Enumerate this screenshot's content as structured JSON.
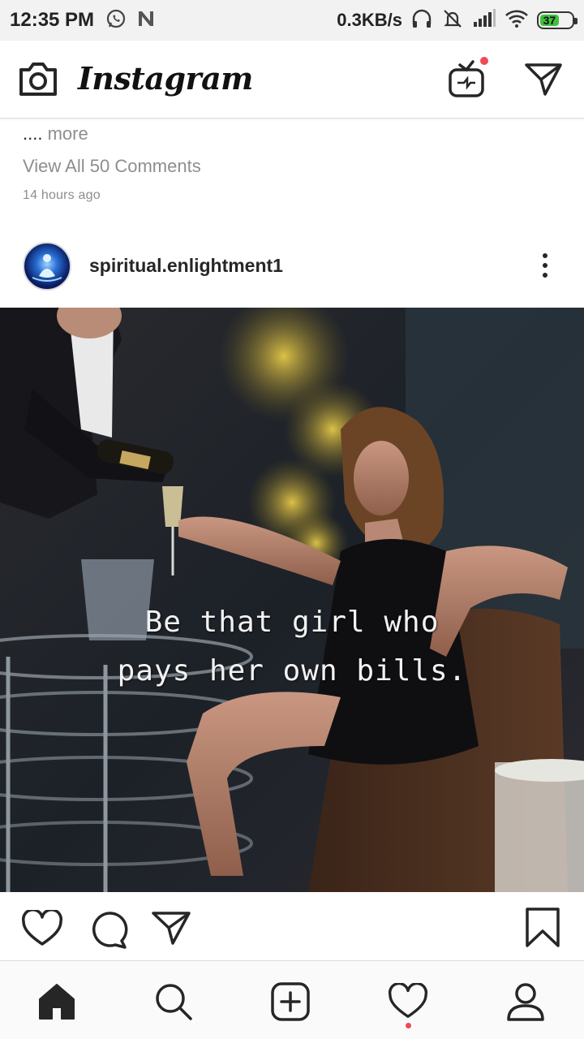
{
  "status_bar": {
    "time": "12:35 PM",
    "network_speed": "0.3KB/s",
    "battery": "37",
    "battery_level_pct": 37,
    "battery_color": "#3fbf3f"
  },
  "app": {
    "title": "Instagram",
    "notification_dot_color": "#ed4956"
  },
  "previous_post": {
    "more_dots": "....",
    "more_label": " more",
    "view_comments": "View All 50 Comments",
    "time_ago": "14 hours ago"
  },
  "post": {
    "username": "spiritual.enlightment1",
    "image_text_line1": "Be that girl who",
    "image_text_line2": "pays her own bills."
  },
  "icons": {
    "camera": "camera-icon",
    "igtv": "igtv-icon",
    "direct": "direct-message-icon",
    "like": "heart-icon",
    "comment": "comment-icon",
    "share": "send-icon",
    "save": "bookmark-icon",
    "home": "home-icon",
    "search": "search-icon",
    "new_post": "plus-square-icon",
    "activity": "heart-icon",
    "profile": "profile-icon"
  }
}
